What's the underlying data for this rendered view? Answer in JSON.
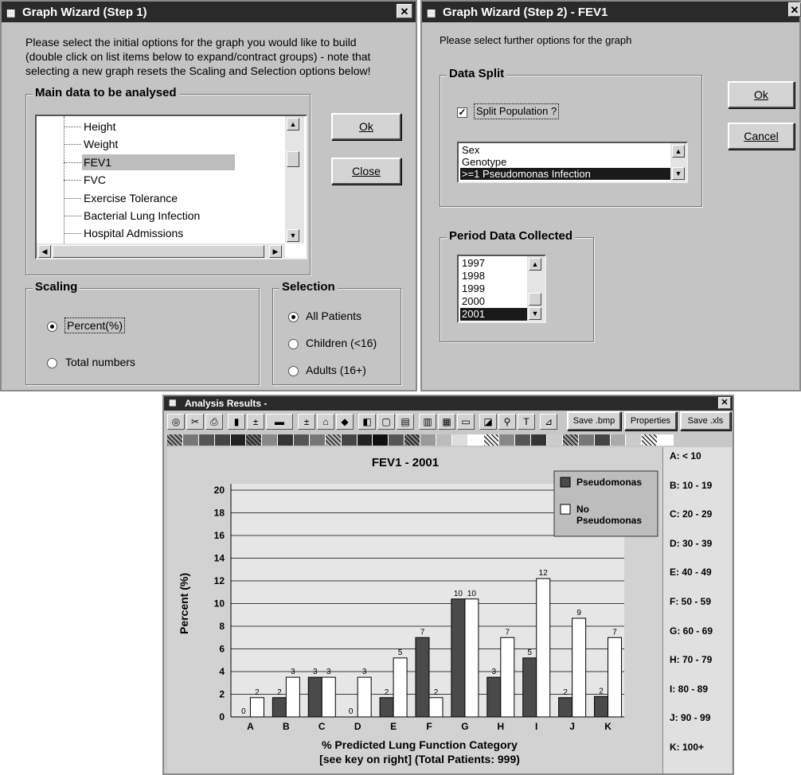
{
  "step1": {
    "title": "Graph Wizard (Step 1)",
    "close_glyph": "✕",
    "intro_line1": "Please select the initial options for the graph you would like to build",
    "intro_line2": "(double click on list items below to expand/contract groups) - note that",
    "intro_line3": "selecting a new graph resets the Scaling and Selection options below!",
    "main_group": "Main data to be analysed",
    "items": [
      "Height",
      "Weight",
      "FEV1",
      "FVC",
      "Exercise Tolerance",
      "Bacterial Lung Infection",
      "Hospital Admissions"
    ],
    "selected_item": "FEV1",
    "ok_label": "Ok",
    "close_label": "Close",
    "scaling_label": "Scaling",
    "scaling_options": [
      "Percent(%)",
      "Total numbers"
    ],
    "scaling_selected": "Percent(%)",
    "selection_label": "Selection",
    "selection_options": [
      "All Patients",
      "Children (<16)",
      "Adults (16+)"
    ],
    "selection_selected": "All Patients"
  },
  "step2": {
    "title": "Graph Wizard (Step 2) - FEV1",
    "intro": "Please select further options for the graph",
    "ok_label": "Ok",
    "cancel_label": "Cancel",
    "split_group": "Data Split",
    "split_checkbox_label": "Split Population ?",
    "split_checked": true,
    "split_items": [
      "Sex",
      "Genotype",
      ">=1 Pseudomonas Infection"
    ],
    "split_selected": ">=1 Pseudomonas Infection",
    "period_group": "Period Data Collected",
    "years": [
      "1997",
      "1998",
      "1999",
      "2000",
      "2001"
    ],
    "year_selected": "2001"
  },
  "results": {
    "title": "Analysis Results -",
    "save_bmp": "Save .bmp",
    "properties": "Properties",
    "save_xls": "Save .xls",
    "key": [
      "A: < 10",
      "B: 10 - 19",
      "C: 20 - 29",
      "D: 30 - 39",
      "E: 40 - 49",
      "F: 50 - 59",
      "G: 60 - 69",
      "H: 70 - 79",
      "I: 80 - 89",
      "J: 90 - 99",
      "K: 100+"
    ]
  },
  "chart_data": {
    "type": "bar",
    "title": "FEV1 - 2001",
    "xlabel": "% Predicted Lung Function Category",
    "xlabel2": "[see key on right] (Total Patients: 999)",
    "ylabel": "Percent (%)",
    "ylim": [
      0,
      20
    ],
    "yticks": [
      0,
      2,
      4,
      6,
      8,
      10,
      12,
      14,
      16,
      18,
      20
    ],
    "categories": [
      "A",
      "B",
      "C",
      "D",
      "E",
      "F",
      "G",
      "H",
      "I",
      "J",
      "K"
    ],
    "series": [
      {
        "name": "Pseudomonas",
        "values": [
          0,
          1.7,
          3.5,
          0,
          1.7,
          7,
          10.4,
          3.5,
          5.2,
          1.7,
          1.8
        ],
        "labels": [
          "0",
          "2",
          "3",
          "0",
          "2",
          "7",
          "10",
          "3",
          "5",
          "2",
          "2"
        ],
        "color": "#4a4a4a"
      },
      {
        "name": "No Pseudomonas",
        "values": [
          1.7,
          3.5,
          3.5,
          3.5,
          5.2,
          1.7,
          10.4,
          7,
          12.2,
          8.7,
          7
        ],
        "labels": [
          "2",
          "3",
          "3",
          "3",
          "5",
          "2",
          "10",
          "7",
          "12",
          "9",
          "7"
        ],
        "color": "#ffffff"
      }
    ],
    "legend": "top-right",
    "grid": true
  }
}
